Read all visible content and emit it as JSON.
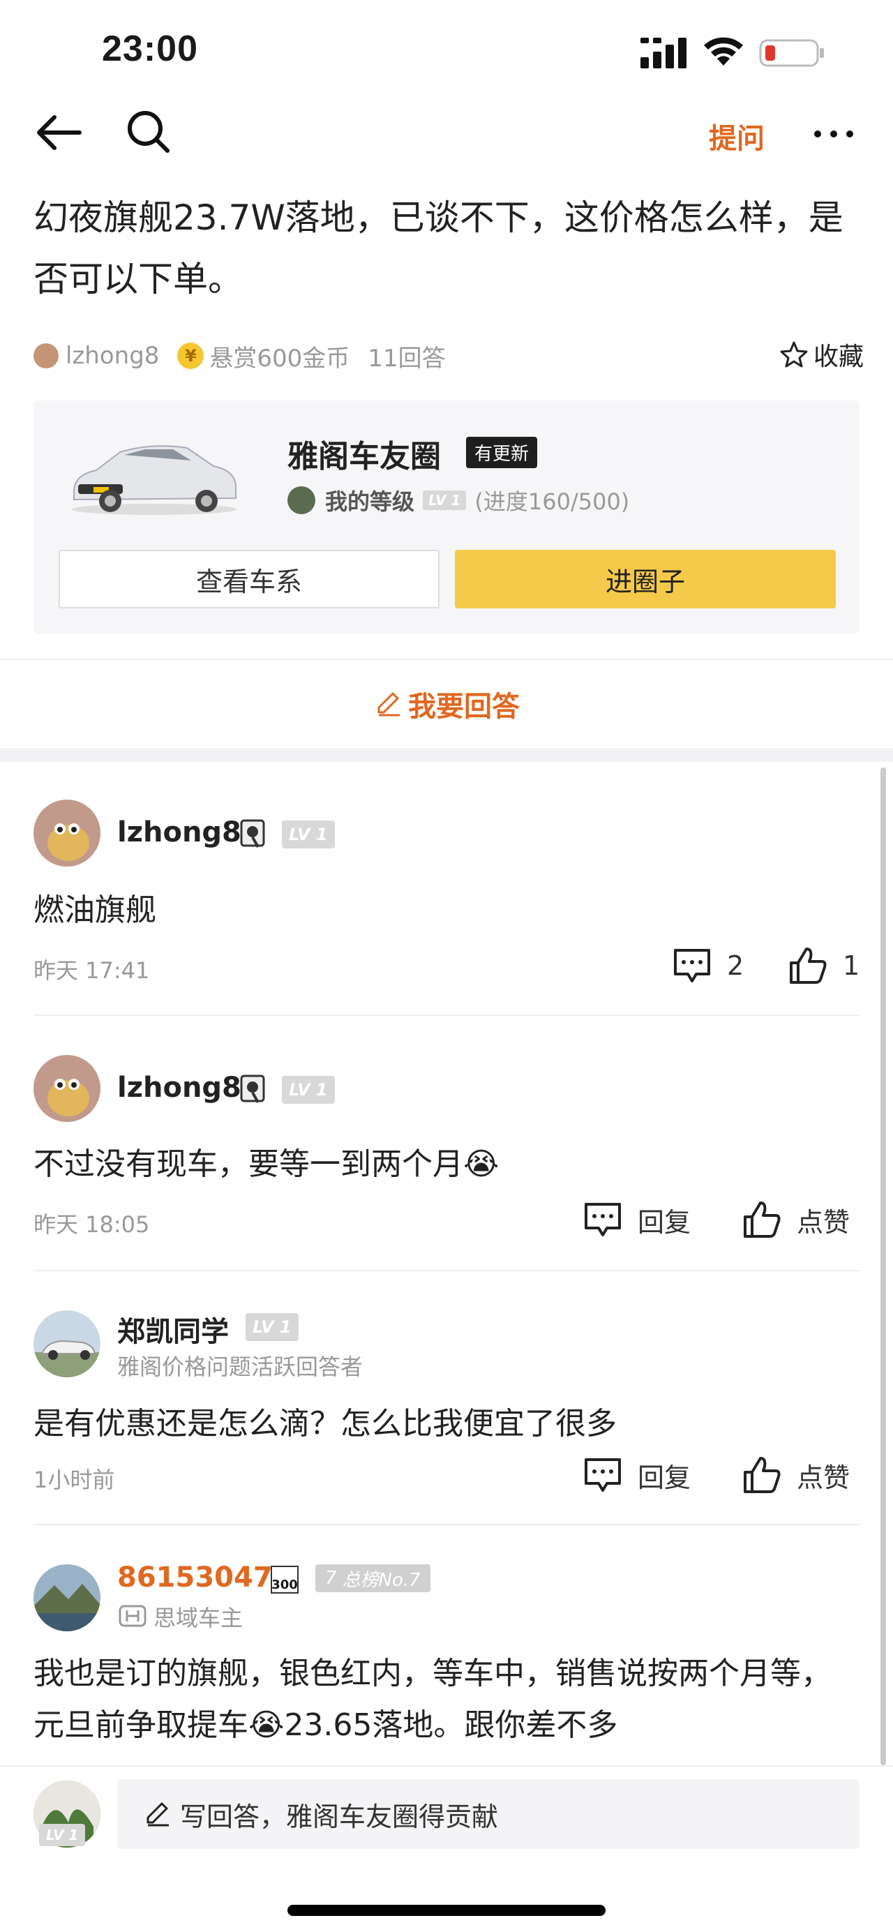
{
  "status_bar": {
    "time": "23:00"
  },
  "nav": {
    "ask_label": "提问"
  },
  "question": {
    "title": "幻夜旗舰23.7W落地，已谈不下，这价格怎么样，是否可以下单。",
    "author": "lzhong8",
    "reward": "悬赏600金币",
    "answer_count": "11回答",
    "favorite_label": "收藏"
  },
  "circle_card": {
    "name": "雅阁车友圈",
    "badge": "有更新",
    "level_label": "我的等级",
    "level_badge": "LV 1",
    "progress": "(进度160/500)",
    "view_series_label": "查看车系",
    "join_label": "进圈子"
  },
  "answer_button_label": "我要回答",
  "replies": [
    {
      "name": "lzhong8",
      "level": "LV 1",
      "text": "燃油旗舰",
      "time": "昨天 17:41",
      "comment_count": "2",
      "like_count": "1"
    },
    {
      "name": "lzhong8",
      "level": "LV 1",
      "text": "不过没有现车，要等一到两个月😭",
      "time": "昨天 18:05",
      "reply_label": "回复",
      "like_label": "点赞"
    },
    {
      "name": "郑凯同学",
      "level": "LV 1",
      "subtitle": "雅阁价格问题活跃回答者",
      "text": "是有优惠还是怎么滴？怎么比我便宜了很多",
      "time": "1小时前",
      "reply_label": "回复",
      "like_label": "点赞"
    },
    {
      "name": "86153047",
      "score_badge": "300",
      "rank": "总榜No.7",
      "rank_number": "7",
      "subtitle": "思域车主",
      "text": "我也是订的旗舰，银色红内，等车中，销售说按两个月等，元旦前争取提车😭23.65落地。跟你差不多"
    }
  ],
  "bottom_bar": {
    "placeholder": "写回答，雅阁车友圈得贡献",
    "avatar_level": "LV 1"
  },
  "colors": {
    "accent": "#e06820",
    "join_button": "#f5c94a",
    "text_muted": "#999999"
  }
}
